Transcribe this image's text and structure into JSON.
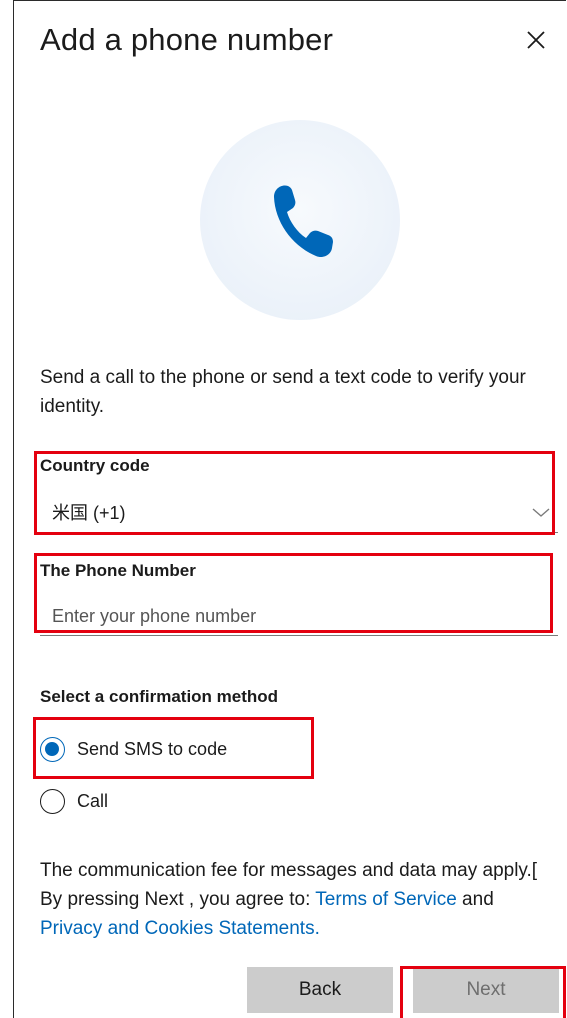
{
  "dialog": {
    "title": "Add a phone number",
    "description": "Send a call to the phone or send a text code to verify your identity."
  },
  "country": {
    "label": "Country code",
    "selected": "米国 (+1)"
  },
  "phone": {
    "label": "The Phone Number",
    "placeholder": "Enter your phone number",
    "value": ""
  },
  "method": {
    "label": "Select a confirmation method",
    "options": [
      {
        "label": "Send SMS to code",
        "checked": true
      },
      {
        "label": "Call",
        "checked": false
      }
    ]
  },
  "fine_print": {
    "text_1": "The communication fee for messages and data may apply.[ By pressing Next , you agree to: ",
    "terms_link": "Terms of Service",
    "text_2": " and ",
    "privacy_link": "Privacy and Cookies Statements."
  },
  "buttons": {
    "back": "Back",
    "next": "Next"
  },
  "colors": {
    "accent": "#0067b8",
    "highlight_box": "#e4000f",
    "button_bg": "#cccccc"
  },
  "icons": {
    "close": "close-icon",
    "hero": "phone-icon",
    "dropdown": "chevron-down-icon"
  }
}
